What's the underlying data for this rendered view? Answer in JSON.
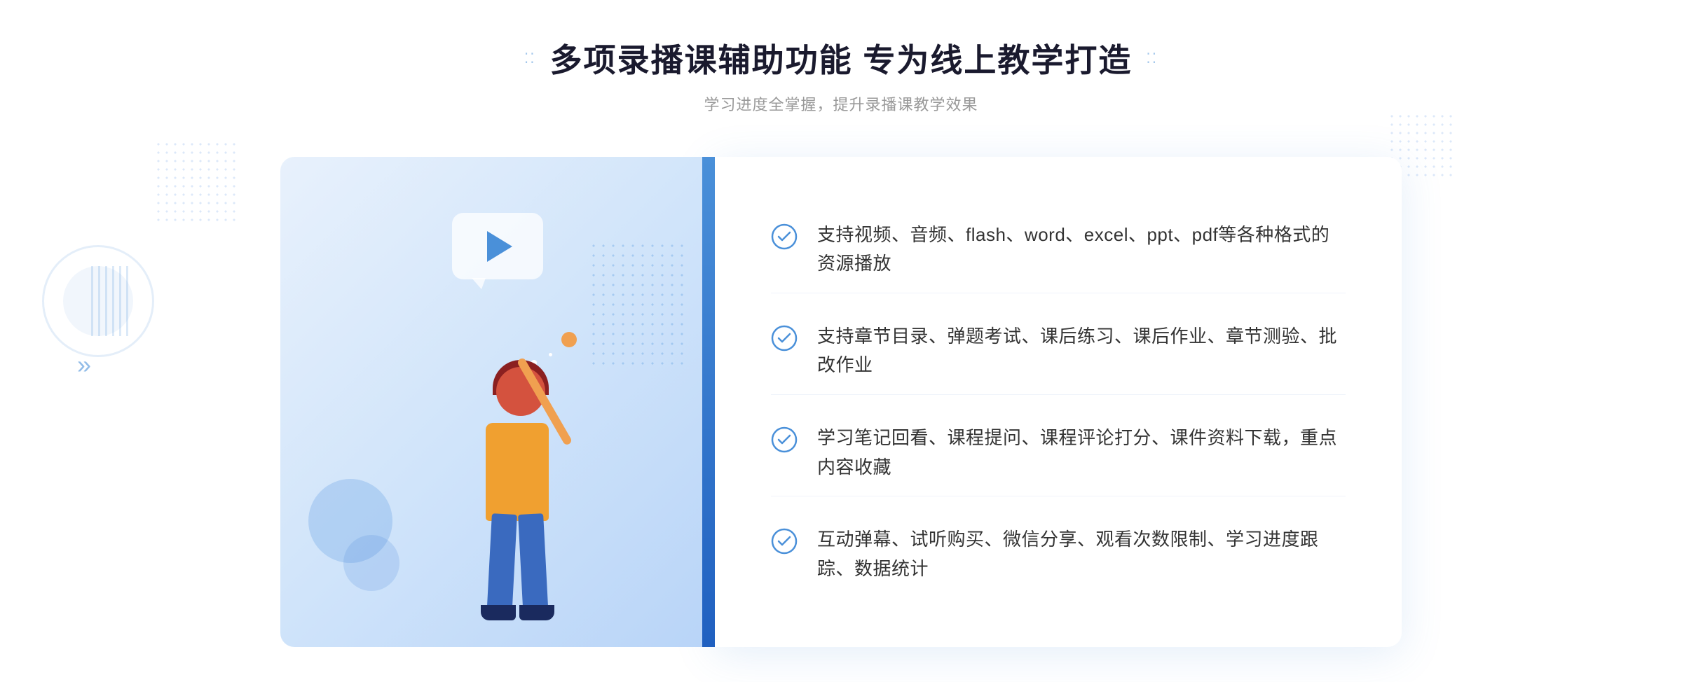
{
  "header": {
    "dots_left": "⁚⁚",
    "dots_right": "⁚⁚",
    "title": "多项录播课辅助功能 专为线上教学打造",
    "subtitle": "学习进度全掌握，提升录播课教学效果"
  },
  "features": [
    {
      "id": 1,
      "text": "支持视频、音频、flash、word、excel、ppt、pdf等各种格式的资源播放"
    },
    {
      "id": 2,
      "text": "支持章节目录、弹题考试、课后练习、课后作业、章节测验、批改作业"
    },
    {
      "id": 3,
      "text": "学习笔记回看、课程提问、课程评论打分、课件资料下载，重点内容收藏"
    },
    {
      "id": 4,
      "text": "互动弹幕、试听购买、微信分享、观看次数限制、学习进度跟踪、数据统计"
    }
  ],
  "colors": {
    "primary": "#4a90d9",
    "title": "#1a1a2e",
    "text": "#333333",
    "subtitle": "#999999",
    "check": "#4a90d9"
  },
  "decoration": {
    "chevron": "»"
  }
}
